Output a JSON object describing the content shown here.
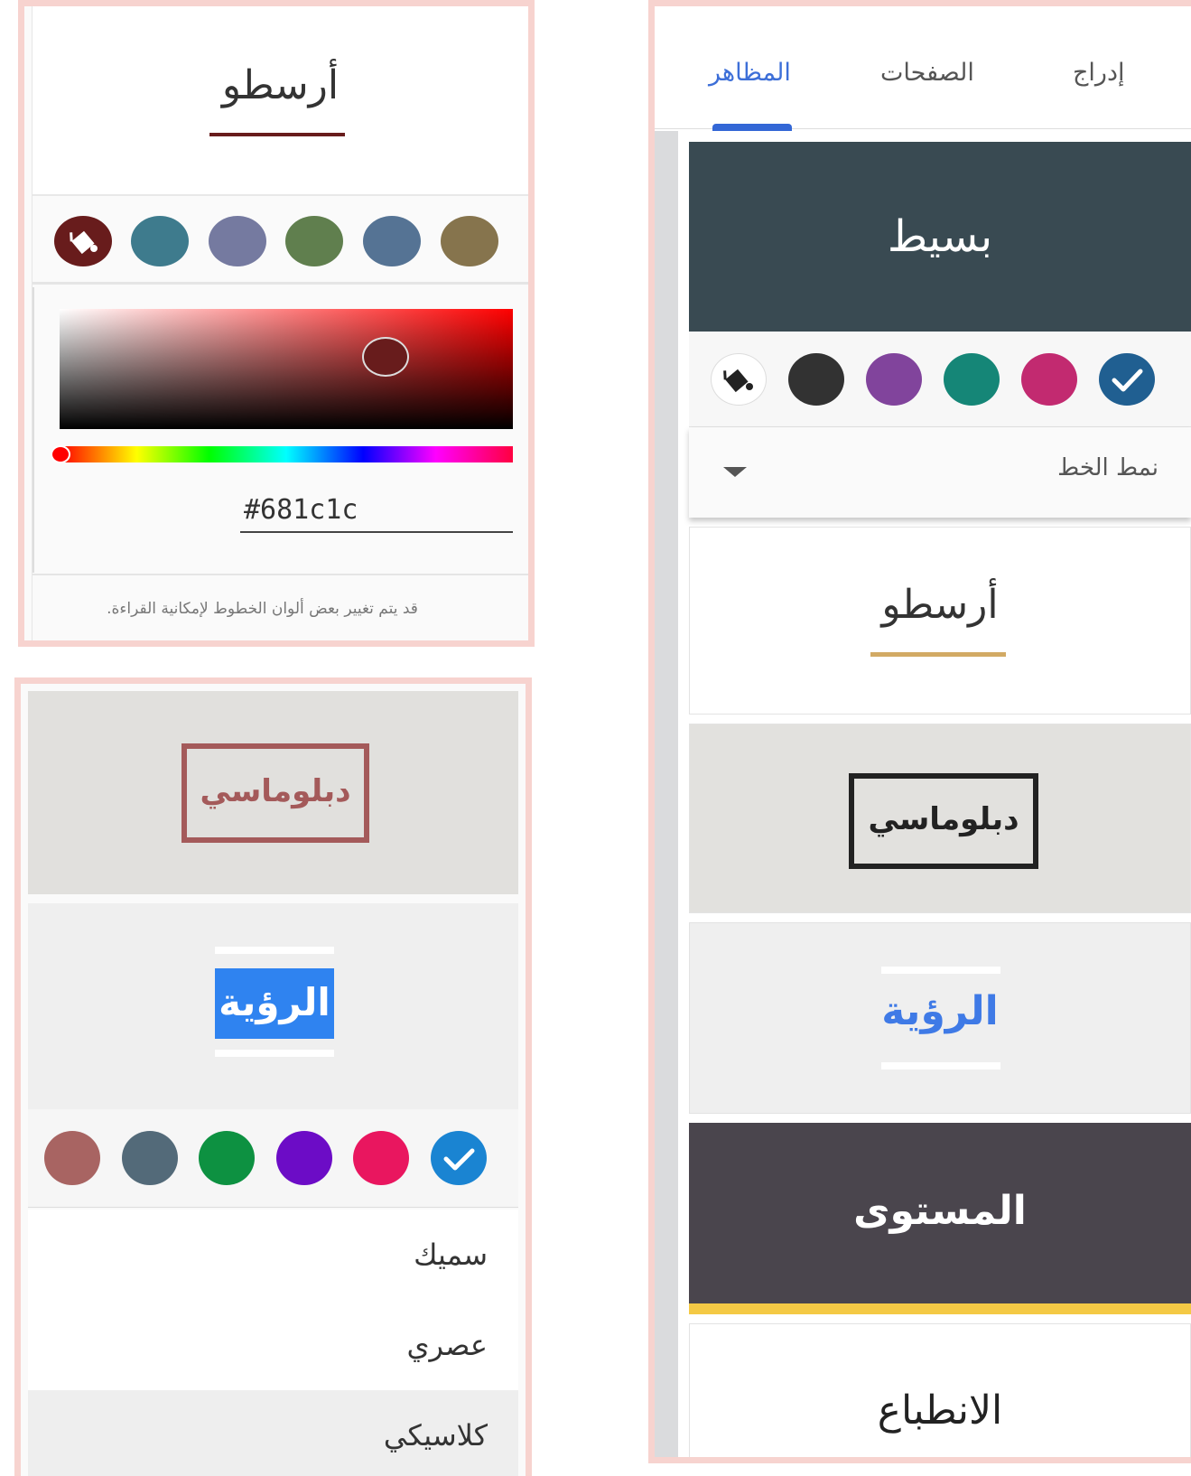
{
  "panel_custom_color": {
    "theme_title": "أرسطو",
    "underline_color": "#681c1c",
    "swatches": [
      {
        "color": "#681c1c",
        "icon": "paint-bucket-icon",
        "selected": true
      },
      {
        "color": "#3e7b8d"
      },
      {
        "color": "#757aa0"
      },
      {
        "color": "#607f4e"
      },
      {
        "color": "#557394"
      },
      {
        "color": "#86744d"
      }
    ],
    "hex_value": "#681c1c",
    "note": "قد يتم تغيير بعض ألوان الخطوط لإمكانية القراءة."
  },
  "panel_diplomatic": {
    "diplomatic_title": "دبلوماسي",
    "diplomatic_color": "#a45a5a",
    "vision_title": "الرؤية",
    "swatches": [
      {
        "color": "#a86462"
      },
      {
        "color": "#536a79"
      },
      {
        "color": "#0d9141"
      },
      {
        "color": "#6c0cc6"
      },
      {
        "color": "#e9165f"
      },
      {
        "color": "#1a84d2",
        "selected": true,
        "icon": "check-icon"
      }
    ],
    "font_options": [
      "سميك",
      "عصري",
      "كلاسيكي"
    ],
    "selected_font": "كلاسيكي"
  },
  "panel_themes": {
    "tabs": [
      "إدراج",
      "الصفحات",
      "المظاهر"
    ],
    "active_tab": "المظاهر",
    "simple": {
      "title": "بسيط",
      "swatches": [
        {
          "color": "#ffffff",
          "icon": "paint-bucket-icon"
        },
        {
          "color": "#323232"
        },
        {
          "color": "#81449c"
        },
        {
          "color": "#158677"
        },
        {
          "color": "#c22a70"
        },
        {
          "color": "#205f91",
          "selected": true,
          "icon": "check-icon"
        }
      ],
      "font_style_label": "نمط الخط"
    },
    "themes": [
      {
        "name": "أرسطو"
      },
      {
        "name": "دبلوماسي"
      },
      {
        "name": "الرؤية"
      },
      {
        "name": "المستوى"
      },
      {
        "name": "الانطباع"
      }
    ]
  }
}
